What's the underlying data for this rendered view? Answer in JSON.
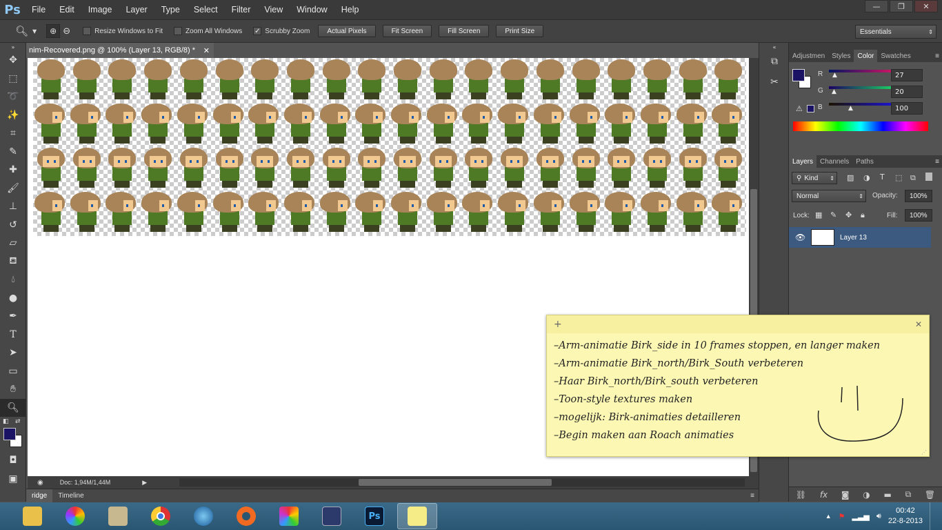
{
  "app": {
    "logo": "Ps"
  },
  "menu": [
    "File",
    "Edit",
    "Image",
    "Layer",
    "Type",
    "Select",
    "Filter",
    "View",
    "Window",
    "Help"
  ],
  "window_controls": {
    "minimize": "—",
    "restore": "❐",
    "close": "✕"
  },
  "options_bar": {
    "resize_windows": "Resize Windows to Fit",
    "zoom_all": "Zoom All Windows",
    "scrubby": "Scrubby Zoom",
    "scrubby_checked": "✓",
    "actual_pixels": "Actual Pixels",
    "fit_screen": "Fit Screen",
    "fill_screen": "Fill Screen",
    "print_size": "Print Size",
    "workspace": "Essentials"
  },
  "document": {
    "tab_title": "nim-Recovered.png @ 100% (Layer 13, RGB/8) *",
    "close": "✕"
  },
  "status": {
    "doc_size": "Doc: 1,94M/1,44M"
  },
  "bottom_tabs": [
    "ridge",
    "Timeline"
  ],
  "color_panel": {
    "tabs": [
      "Adjustmen",
      "Styles",
      "Color",
      "Swatches"
    ],
    "active_tab": "Color",
    "r_label": "R",
    "g_label": "G",
    "b_label": "B",
    "r": "27",
    "g": "20",
    "b": "100",
    "foreground": "#1b1464"
  },
  "layers_panel": {
    "tabs": [
      "Layers",
      "Channels",
      "Paths"
    ],
    "active_tab": "Layers",
    "filter_kind": "Kind",
    "blend_mode": "Normal",
    "opacity_label": "Opacity:",
    "opacity": "100%",
    "lock_label": "Lock:",
    "fill_label": "Fill:",
    "fill": "100%",
    "layers": [
      {
        "name": "Layer 13",
        "visible": true
      }
    ]
  },
  "sticky_note": {
    "add": "+",
    "close": "✕",
    "lines": [
      "–Arm-animatie Birk_side in 10 frames stoppen, en langer maken",
      "–Arm-animatie Birk_north/Birk_South verbeteren",
      "–Haar Birk_north/Birk_south verbeteren",
      "–Toon-style textures maken",
      "–mogelijk: Birk-animaties detailleren",
      "–Begin maken aan Roach animaties"
    ]
  },
  "taskbar": {
    "apps": [
      "file-explorer",
      "picasa",
      "notepad",
      "chrome",
      "browser-globe",
      "origin",
      "paint-tool",
      "media-creator",
      "photoshop",
      "sticky-notes"
    ],
    "time": "00:42",
    "date": "22-8-2013"
  }
}
